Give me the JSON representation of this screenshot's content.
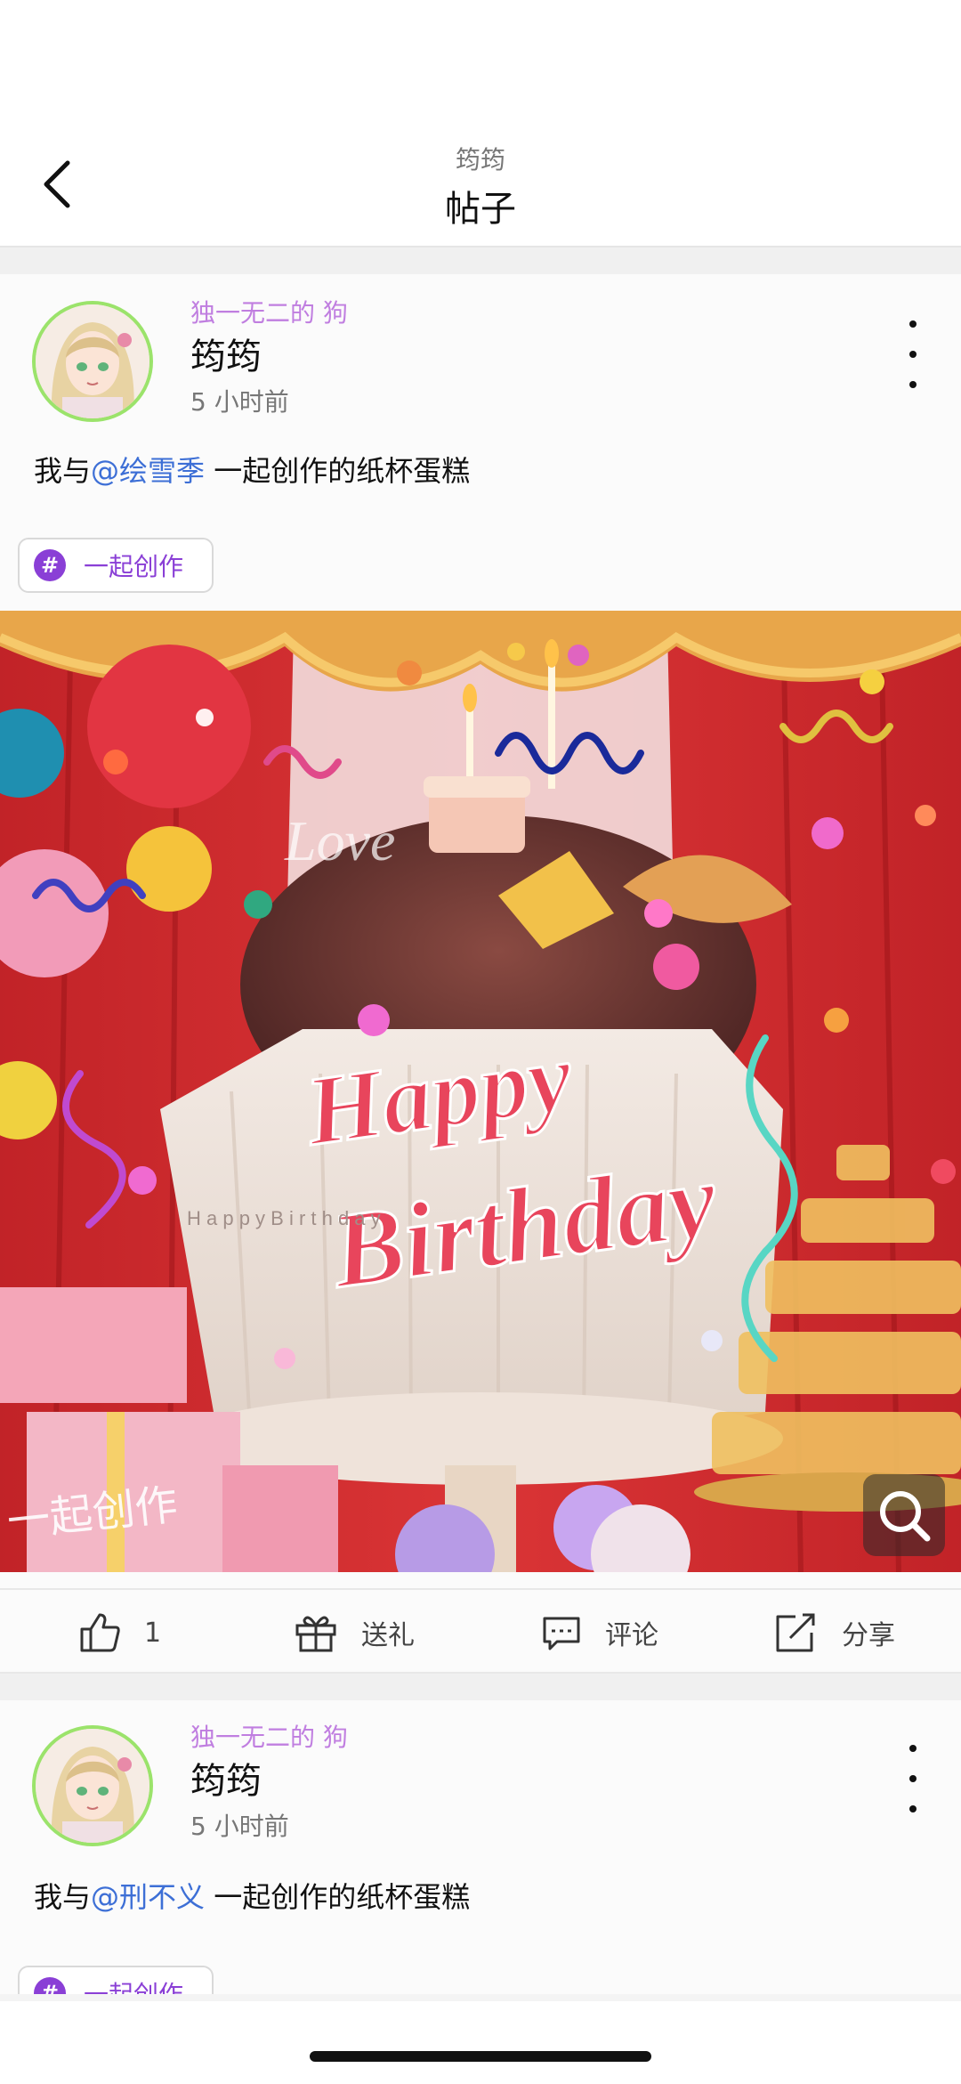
{
  "header": {
    "subtitle": "筠筠",
    "title": "帖子"
  },
  "posts": [
    {
      "group": "独一无二的 狗",
      "author": "筠筠",
      "time": "5 小时前",
      "text_prefix": "我与",
      "mention": "@绘雪季",
      "text_suffix": " 一起创作的纸杯蛋糕",
      "tag": "一起创作",
      "image": {
        "headline_1": "Happy",
        "headline_2": "Birthday",
        "spaced_text": "H a p p y   B i r t h d a y",
        "watermark": "一起创作",
        "love_text": "Love"
      }
    },
    {
      "group": "独一无二的 狗",
      "author": "筠筠",
      "time": "5 小时前",
      "text_prefix": "我与",
      "mention": "@刑不义",
      "text_suffix": " 一起创作的纸杯蛋糕",
      "tag": "一起创作"
    }
  ],
  "actions": {
    "like_count": "1",
    "gift": "送礼",
    "comment": "评论",
    "share": "分享"
  },
  "colors": {
    "accent_purple": "#8a3fd6",
    "group_purple": "#c07ee0",
    "mention_blue": "#3d6fd6",
    "curtain_red": "#c9242b"
  }
}
